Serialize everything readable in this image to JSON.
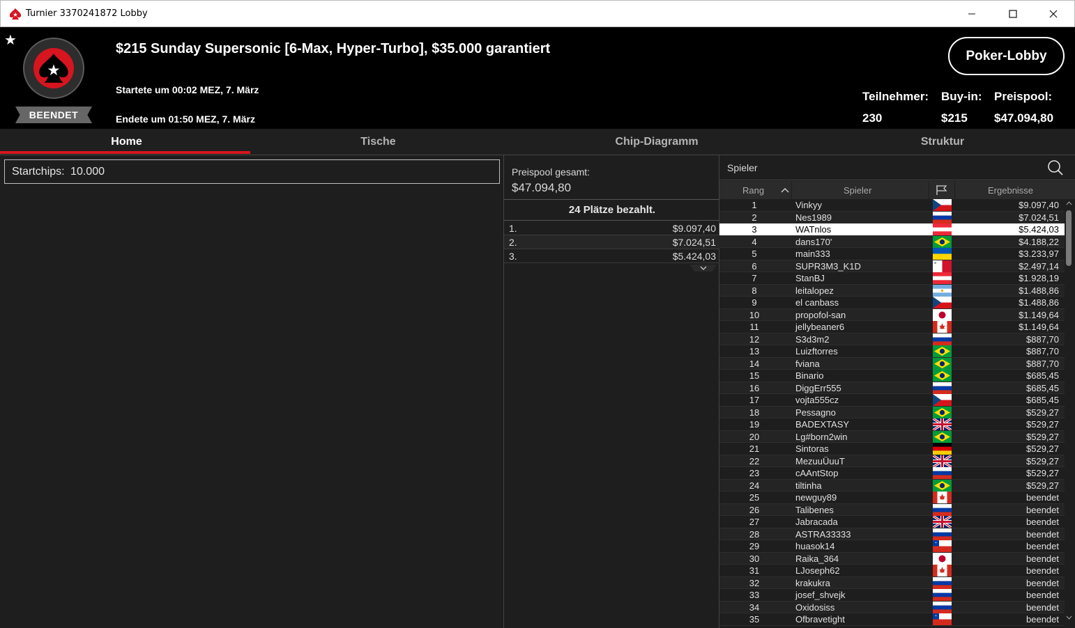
{
  "window": {
    "title": "Turnier 3370241872 Lobby"
  },
  "header": {
    "status_ribbon": "BEENDET",
    "tournament_title": "$215 Sunday Supersonic [6-Max, Hyper-Turbo], $35.000 garantiert",
    "started": "Startete um 00:02 MEZ, 7. März",
    "ended": "Endete um 01:50 MEZ, 7. März",
    "lobby_button": "Poker-Lobby",
    "stats": [
      {
        "label": "Teilnehmer:",
        "value": "230"
      },
      {
        "label": "Buy-in:",
        "value": "$215"
      },
      {
        "label": "Preispool:",
        "value": "$47.094,80"
      }
    ]
  },
  "tabs": [
    {
      "label": "Home",
      "active": true
    },
    {
      "label": "Tische",
      "active": false
    },
    {
      "label": "Chip-Diagramm",
      "active": false
    },
    {
      "label": "Struktur",
      "active": false
    }
  ],
  "home": {
    "startchips_label": "Startchips:",
    "startchips_value": "10.000"
  },
  "prizepool": {
    "label": "Preispool gesamt:",
    "value": "$47.094,80",
    "paid_places": "24 Plätze bezahlt.",
    "places": [
      {
        "place": "1.",
        "amount": "$9.097,40"
      },
      {
        "place": "2.",
        "amount": "$7.024,51"
      },
      {
        "place": "3.",
        "amount": "$5.424,03"
      }
    ]
  },
  "players": {
    "search_label": "Spieler",
    "columns": {
      "rank": "Rang",
      "player": "Spieler",
      "result": "Ergebnisse"
    },
    "selected_rank": "3",
    "rows": [
      {
        "rank": "1",
        "name": "Vinkyy",
        "flag": "cz",
        "result": "$9.097,40"
      },
      {
        "rank": "2",
        "name": "Nes1989",
        "flag": "ru",
        "result": "$7.024,51"
      },
      {
        "rank": "3",
        "name": "WATnlos",
        "flag": "at",
        "result": "$5.424,03"
      },
      {
        "rank": "4",
        "name": "dans170'",
        "flag": "br",
        "result": "$4.188,22"
      },
      {
        "rank": "5",
        "name": "main333",
        "flag": "ua",
        "result": "$3.233,97"
      },
      {
        "rank": "6",
        "name": "SUPR3M3_K1D",
        "flag": "mt",
        "result": "$2.497,14"
      },
      {
        "rank": "7",
        "name": "StanBJ",
        "flag": "at",
        "result": "$1.928,19"
      },
      {
        "rank": "8",
        "name": "leitalopez",
        "flag": "ar",
        "result": "$1.488,86"
      },
      {
        "rank": "9",
        "name": "el canbass",
        "flag": "cz",
        "result": "$1.488,86"
      },
      {
        "rank": "10",
        "name": "propofol-san",
        "flag": "jp",
        "result": "$1.149,64"
      },
      {
        "rank": "11",
        "name": "jellybeaner6",
        "flag": "ca",
        "result": "$1.149,64"
      },
      {
        "rank": "12",
        "name": "S3d3m2",
        "flag": "ru",
        "result": "$887,70"
      },
      {
        "rank": "13",
        "name": "Luizftorres",
        "flag": "br",
        "result": "$887,70"
      },
      {
        "rank": "14",
        "name": "fviana",
        "flag": "br",
        "result": "$887,70"
      },
      {
        "rank": "15",
        "name": "Binario",
        "flag": "br",
        "result": "$685,45"
      },
      {
        "rank": "16",
        "name": "DiggErr555",
        "flag": "ru",
        "result": "$685,45"
      },
      {
        "rank": "17",
        "name": "vojta555cz",
        "flag": "cz",
        "result": "$685,45"
      },
      {
        "rank": "18",
        "name": "Pessagno",
        "flag": "br",
        "result": "$529,27"
      },
      {
        "rank": "19",
        "name": "BADEXTASY",
        "flag": "gb",
        "result": "$529,27"
      },
      {
        "rank": "20",
        "name": "Lg#born2win",
        "flag": "br",
        "result": "$529,27"
      },
      {
        "rank": "21",
        "name": "Sintoras",
        "flag": "de",
        "result": "$529,27"
      },
      {
        "rank": "22",
        "name": "MezuuÜuuT",
        "flag": "gb",
        "result": "$529,27"
      },
      {
        "rank": "23",
        "name": "cAAntStop",
        "flag": "ru",
        "result": "$529,27"
      },
      {
        "rank": "24",
        "name": "tiltinha",
        "flag": "br",
        "result": "$529,27"
      },
      {
        "rank": "25",
        "name": "newguy89",
        "flag": "ca",
        "result": "beendet"
      },
      {
        "rank": "26",
        "name": "Talibenes",
        "flag": "ru",
        "result": "beendet"
      },
      {
        "rank": "27",
        "name": "Jabracada",
        "flag": "gb",
        "result": "beendet"
      },
      {
        "rank": "28",
        "name": "ASTRA33333",
        "flag": "ru",
        "result": "beendet"
      },
      {
        "rank": "29",
        "name": "huasok14",
        "flag": "cl",
        "result": "beendet"
      },
      {
        "rank": "30",
        "name": "Raika_364",
        "flag": "jp",
        "result": "beendet"
      },
      {
        "rank": "31",
        "name": "LJoseph62",
        "flag": "ca",
        "result": "beendet"
      },
      {
        "rank": "32",
        "name": "krakukra",
        "flag": "ru",
        "result": "beendet"
      },
      {
        "rank": "33",
        "name": "josef_shvejk",
        "flag": "ru",
        "result": "beendet"
      },
      {
        "rank": "34",
        "name": "Oxidosiss",
        "flag": "ru",
        "result": "beendet"
      },
      {
        "rank": "35",
        "name": "Ofbravetight",
        "flag": "cl",
        "result": "beendet"
      }
    ]
  },
  "colors": {
    "accent": "#d6151f",
    "background": "#1e1e1e",
    "header": "#000000"
  }
}
